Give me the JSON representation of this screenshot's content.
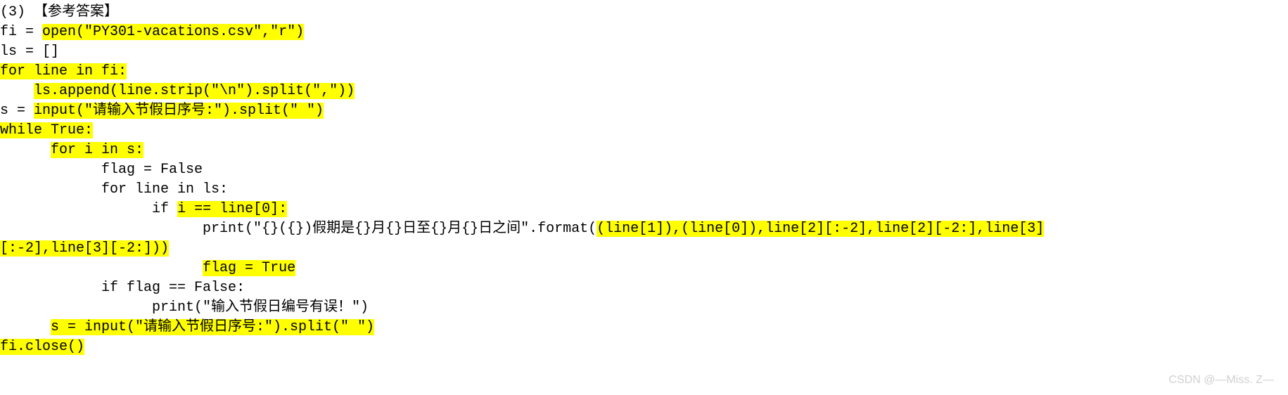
{
  "header": {
    "prefix": "(3) 【参考答案】"
  },
  "code": {
    "l1_pre": "fi = ",
    "l1_hl": "open(\"PY301-vacations.csv\",\"r\")",
    "l2": "ls = []",
    "l3_hl": "for line in fi:",
    "l4_pre": "    ",
    "l4_hl": "ls.append(line.strip(\"\\n\").split(\",\"))",
    "l5_pre": "s = ",
    "l5_hl": "input(\"请输入节假日序号:\").split(\" \")",
    "l6_hl": "while True:",
    "l7_pre": "      ",
    "l7_hl": "for i in s:",
    "l8": "            flag = False",
    "l9": "            for line in ls:",
    "l10_pre": "                  if ",
    "l10_hl": "i == line[0]:",
    "l11_pre": "                        print(\"{}({})假期是{}月{}日至{}月{}日之间\".format(",
    "l11_hl": "(line[1]),(line[0]),line[2][:-2],line[2][-2:],line[3][:-2],line[3][-2:]))",
    "l12_pre": "                        ",
    "l12_hl": "flag = True",
    "l13": "            if flag == False:",
    "l14": "                  print(\"输入节假日编号有误！\")",
    "l15_pre": "      ",
    "l15_hl": "s = input(\"请输入节假日序号:\").split(\" \")",
    "l16_hl": "fi.close()"
  },
  "watermark": "CSDN @—Miss. Z—"
}
